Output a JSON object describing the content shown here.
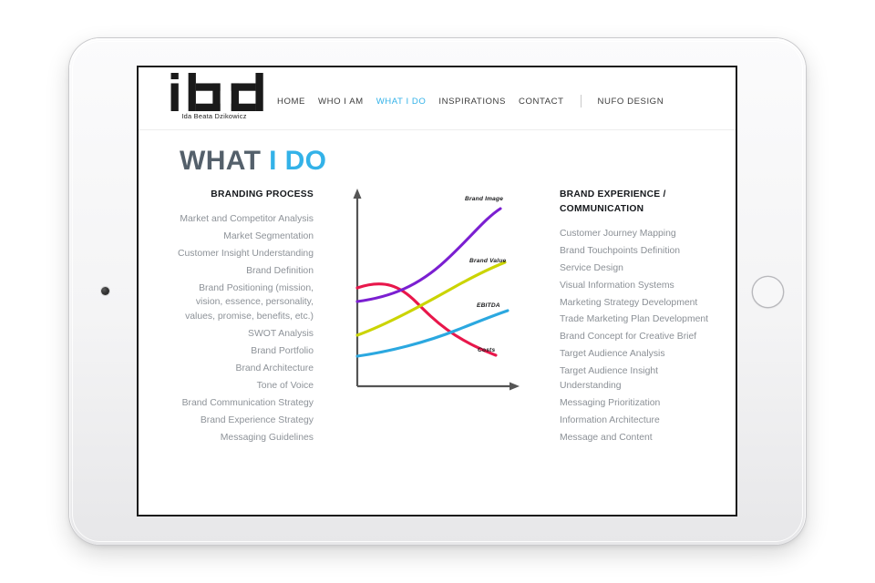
{
  "device": {
    "type": "tablet",
    "orientation": "landscape",
    "camera_icon": "camera-dot",
    "home_button_icon": "home-button-circle"
  },
  "site": {
    "logo": {
      "mark": "ibd",
      "subtitle": "Ida Beata Dzikowicz"
    },
    "nav": [
      {
        "label": "HOME",
        "active": false
      },
      {
        "label": "WHO I AM",
        "active": false
      },
      {
        "label": "WHAT I DO",
        "active": true
      },
      {
        "label": "INSPIRATIONS",
        "active": false
      },
      {
        "label": "CONTACT",
        "active": false
      },
      {
        "label": "NUFO DESIGN",
        "active": false
      }
    ],
    "nav_separator_after": "CONTACT",
    "accent_color": "#33b2e8",
    "title_color": "#54606b"
  },
  "page": {
    "title_plain": "WHAT ",
    "title_accent": "I DO"
  },
  "columns": {
    "left": {
      "heading": "BRANDING PROCESS",
      "items": [
        "Market and Competitor Analysis",
        "Market Segmentation",
        "Customer Insight Understanding",
        "Brand Definition",
        "Brand Positioning (mission, vision, essence, personality, values, promise, benefits, etc.)",
        "SWOT Analysis",
        "Brand Portfolio",
        "Brand Architecture",
        "Tone of Voice",
        "Brand Communication Strategy",
        "Brand Experience Strategy",
        "Messaging Guidelines"
      ]
    },
    "right": {
      "heading": "BRAND EXPERIENCE / COMMUNICATION",
      "items": [
        "Customer Journey Mapping",
        "Brand Touchpoints Definition",
        "Service Design",
        "Visual Information Systems",
        "Marketing Strategy Development",
        "Trade Marketing Plan Development",
        "Brand Concept for Creative Brief",
        "Target Audience Analysis",
        "Target Audience Insight Understanding",
        "Messaging Prioritization",
        "Information Architecture",
        "Message and Content"
      ]
    }
  },
  "chart_data": {
    "type": "line",
    "title": "",
    "xlabel": "",
    "ylabel": "",
    "grid": false,
    "legend": "inline-end-of-line labels",
    "axis_color": "#555555",
    "x": [
      0,
      0.25,
      0.5,
      0.75,
      1
    ],
    "series": [
      {
        "name": "Brand Image",
        "color": "#7B1FD1",
        "values": [
          0.46,
          0.5,
          0.6,
          0.76,
          0.97
        ],
        "label_position": "top-right"
      },
      {
        "name": "Brand Value",
        "color": "#CBD400",
        "values": [
          0.26,
          0.31,
          0.4,
          0.52,
          0.68
        ],
        "label_position": "right"
      },
      {
        "name": "EBITDA",
        "color": "#2BA8E0",
        "values": [
          0.13,
          0.16,
          0.21,
          0.28,
          0.37
        ],
        "label_position": "right"
      },
      {
        "name": "Costs",
        "color": "#E8174B",
        "values": [
          0.6,
          0.59,
          0.49,
          0.33,
          0.15
        ],
        "label_position": "bottom-right"
      }
    ]
  }
}
